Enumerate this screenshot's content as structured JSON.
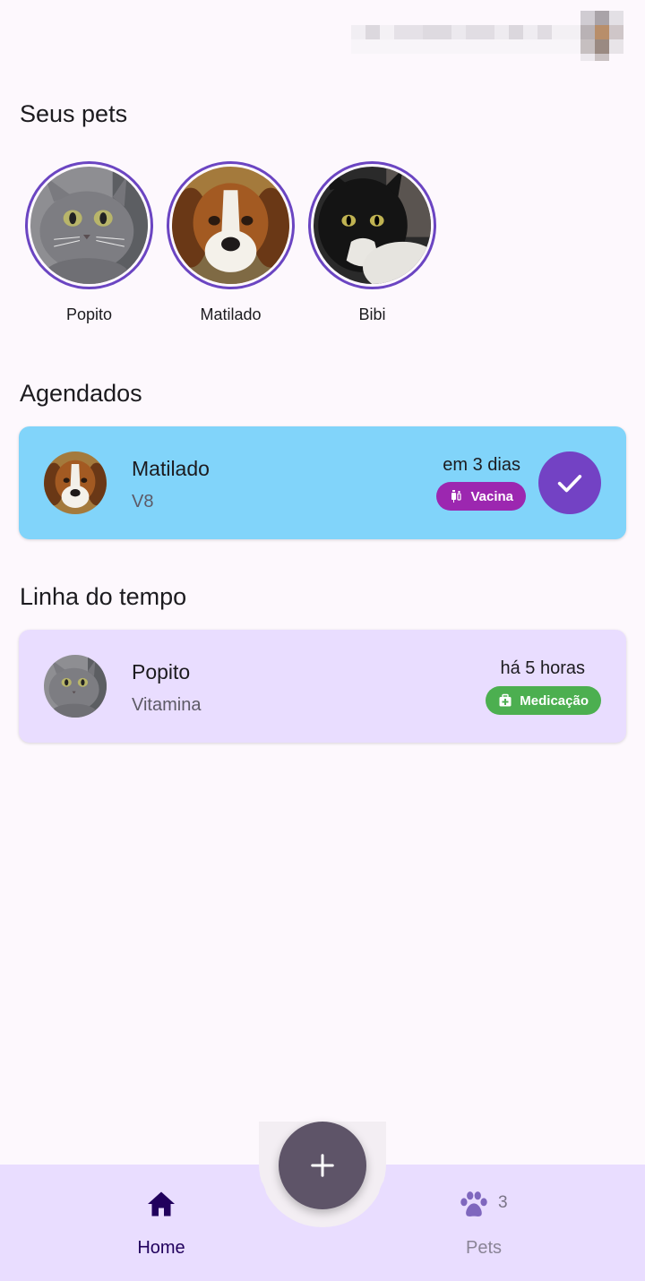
{
  "sections": {
    "pets_title": "Seus pets",
    "scheduled_title": "Agendados",
    "timeline_title": "Linha do tempo"
  },
  "pets": [
    {
      "name": "Popito",
      "photo": "gray-cat"
    },
    {
      "name": "Matilado",
      "photo": "beagle-dog"
    },
    {
      "name": "Bibi",
      "photo": "tuxedo-cat"
    }
  ],
  "scheduled": {
    "pet": "Matilado",
    "description": "V8",
    "when": "em 3 dias",
    "tag": "Vacina",
    "tag_icon": "vaccine-icon",
    "card_color": "#81d4fa",
    "tag_color": "#9c27b0"
  },
  "timeline": {
    "pet": "Popito",
    "description": "Vitamina",
    "when": "há 5 horas",
    "tag": "Medicação",
    "tag_icon": "medical-bag-icon",
    "card_color": "#e9ddff",
    "tag_color": "#4caf50"
  },
  "nav": {
    "home_label": "Home",
    "pets_label": "Pets",
    "pets_count": "3"
  },
  "colors": {
    "accent": "#6b45c2",
    "background": "#fdf8fd",
    "nav_background": "#e9ddff",
    "fab": "#5e5468"
  }
}
